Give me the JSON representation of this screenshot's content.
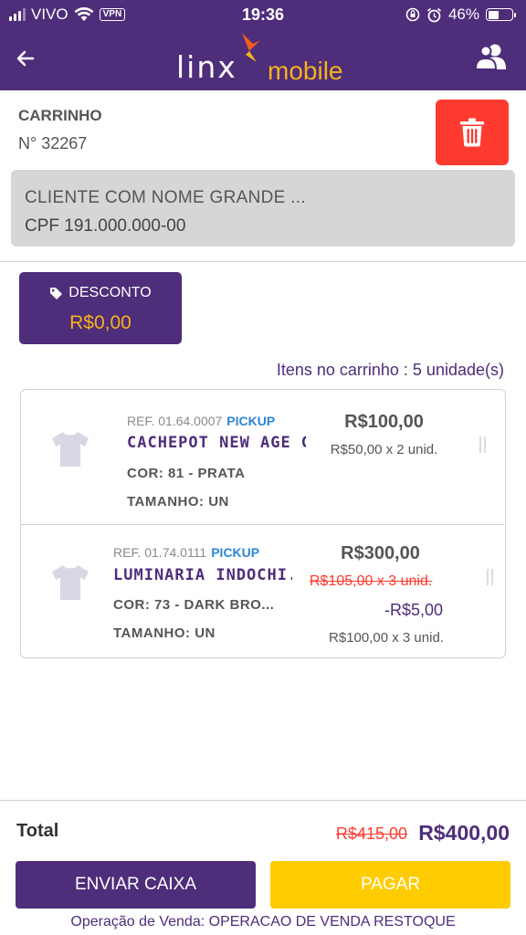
{
  "status_bar": {
    "carrier": "VIVO",
    "vpn": "VPN",
    "time": "19:36",
    "battery": "46%",
    "battery_level": 0.46
  },
  "header": {
    "logo_text": "linx",
    "logo_subtext": "mobile",
    "back_icon": "arrow-left-icon",
    "customers_icon": "users-icon"
  },
  "cart": {
    "label": "CARRINHO",
    "number": "N° 32267",
    "delete_icon": "trash-icon"
  },
  "client": {
    "name": "CLIENTE COM NOME GRANDE ...",
    "cpf": "CPF 191.000.000-00"
  },
  "discount": {
    "label": "DESCONTO",
    "value": "R$0,00",
    "icon": "tag-icon"
  },
  "items_count": "Itens no carrinho : 5 unidade(s)",
  "items": [
    {
      "ref": "REF. 01.64.0007",
      "tag": "PICKUP",
      "name": "CACHEPOT NEW AGE G",
      "color": "COR: 81 - PRATA",
      "size": "TAMANHO: UN",
      "price": "R$100,00",
      "unit_price": "R$50,00 x 2 unid."
    },
    {
      "ref": "REF. 01.74.0111",
      "tag": "PICKUP",
      "name": "LUMINARIA INDOCHI...",
      "color": "COR: 73 - DARK BRO...",
      "size": "TAMANHO: UN",
      "price": "R$300,00",
      "original_unit_price": "R$105,00 x 3 unid.",
      "discount": "-R$5,00",
      "unit_price": "R$100,00 x 3 unid."
    }
  ],
  "footer": {
    "total_label": "Total",
    "total_original": "R$415,00",
    "total": "R$400,00",
    "send_button": "ENVIAR CAIXA",
    "pay_button": "PAGAR",
    "operation": "Operação de Venda: OPERACAO DE VENDA RESTOQUE"
  },
  "colors": {
    "brand_purple": "#4e2d7a",
    "accent_orange": "#f6b21b",
    "danger_red": "#ff3b30",
    "pay_yellow": "#ffcc00",
    "pickup_blue": "#2d86d6"
  }
}
